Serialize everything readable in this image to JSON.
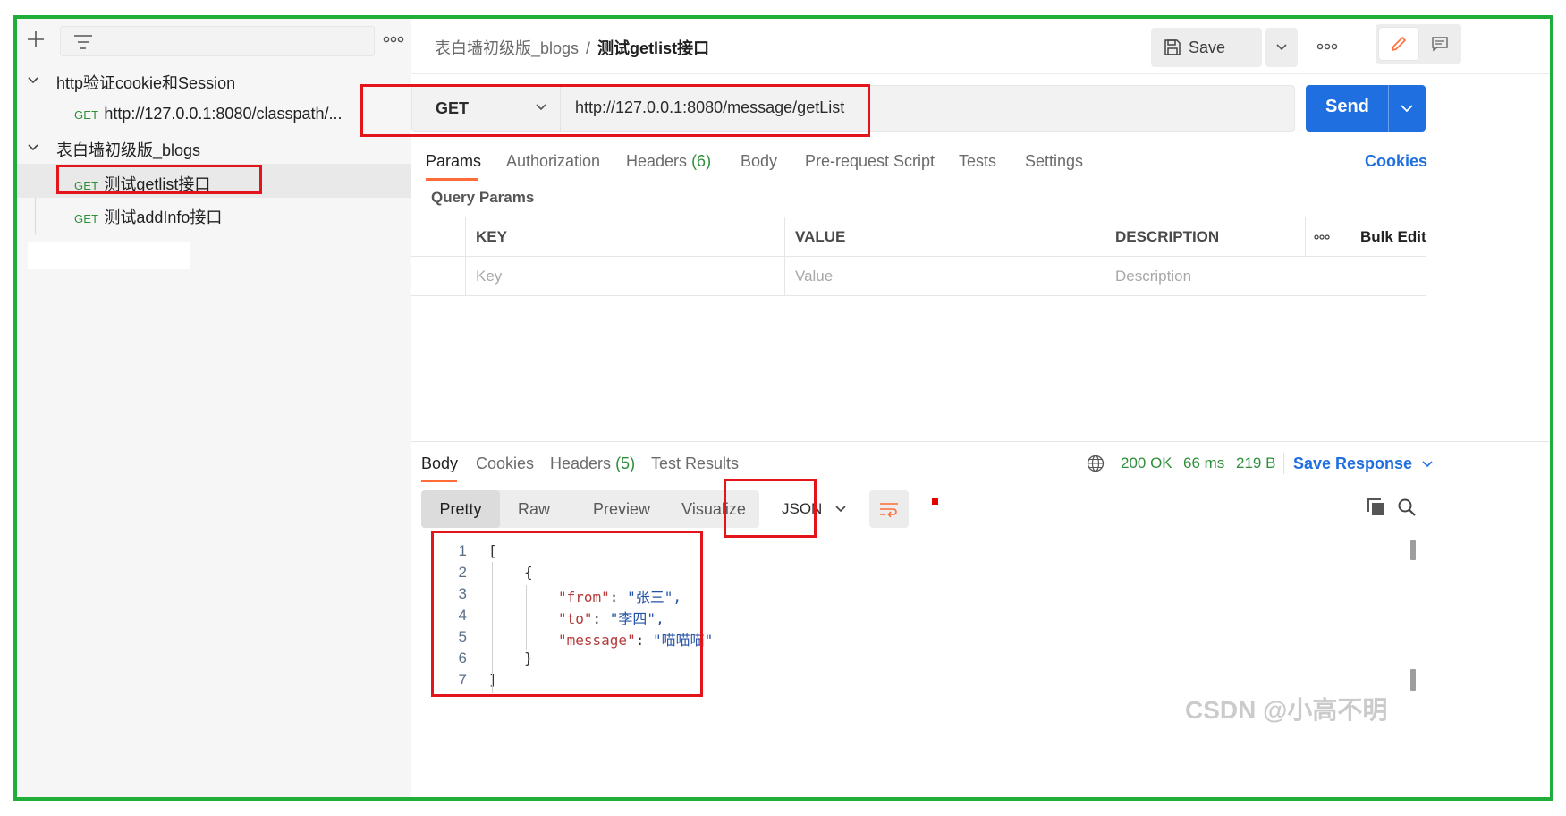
{
  "sidebar": {
    "more_label": "ooo",
    "folders": [
      {
        "name": "http验证cookie和Session",
        "requests": [
          {
            "method": "GET",
            "name": "http://127.0.0.1:8080/classpath/..."
          }
        ]
      },
      {
        "name": "表白墙初级版_blogs",
        "requests": [
          {
            "method": "GET",
            "name": "测试getlist接口"
          },
          {
            "method": "GET",
            "name": "测试addInfo接口"
          }
        ]
      }
    ]
  },
  "header": {
    "breadcrumb_parent": "表白墙初级版_blogs",
    "breadcrumb_sep": "/",
    "breadcrumb_current": "测试getlist接口",
    "save_label": "Save",
    "more_label": "ooo"
  },
  "request": {
    "method": "GET",
    "url": "http://127.0.0.1:8080/message/getList",
    "send_label": "Send",
    "tabs": [
      {
        "label": "Params"
      },
      {
        "label": "Authorization"
      },
      {
        "label": "Headers",
        "count": "(6)"
      },
      {
        "label": "Body"
      },
      {
        "label": "Pre-request Script"
      },
      {
        "label": "Tests"
      },
      {
        "label": "Settings"
      }
    ],
    "cookies_label": "Cookies",
    "query_params_title": "Query Params",
    "table": {
      "headers": [
        "KEY",
        "VALUE",
        "DESCRIPTION"
      ],
      "more_label": "ooo",
      "bulk_edit_label": "Bulk Edit",
      "placeholders": [
        "Key",
        "Value",
        "Description"
      ]
    }
  },
  "response": {
    "tabs": [
      {
        "label": "Body"
      },
      {
        "label": "Cookies"
      },
      {
        "label": "Headers",
        "count": "(5)"
      },
      {
        "label": "Test Results"
      }
    ],
    "status": "200 OK",
    "time": "66 ms",
    "size": "219 B",
    "save_response_label": "Save Response",
    "formats": [
      "Pretty",
      "Raw",
      "Preview",
      "Visualize"
    ],
    "language": "JSON",
    "body_lines": [
      {
        "n": "1",
        "text": "["
      },
      {
        "n": "2",
        "text": "{"
      },
      {
        "n": "3",
        "key": "\"from\"",
        "value": "\"张三\","
      },
      {
        "n": "4",
        "key": "\"to\"",
        "value": "\"李四\","
      },
      {
        "n": "5",
        "key": "\"message\"",
        "value": "\"喵喵喵\""
      },
      {
        "n": "6",
        "text": "}"
      },
      {
        "n": "7",
        "text": "]"
      }
    ]
  },
  "watermark": "CSDN @小高不明",
  "colors": {
    "accent": "#1f6fe0",
    "tab_underline": "#ff6c37",
    "success": "#2e8f3a",
    "highlight": "#e3151a",
    "frame": "#1fae3a"
  }
}
